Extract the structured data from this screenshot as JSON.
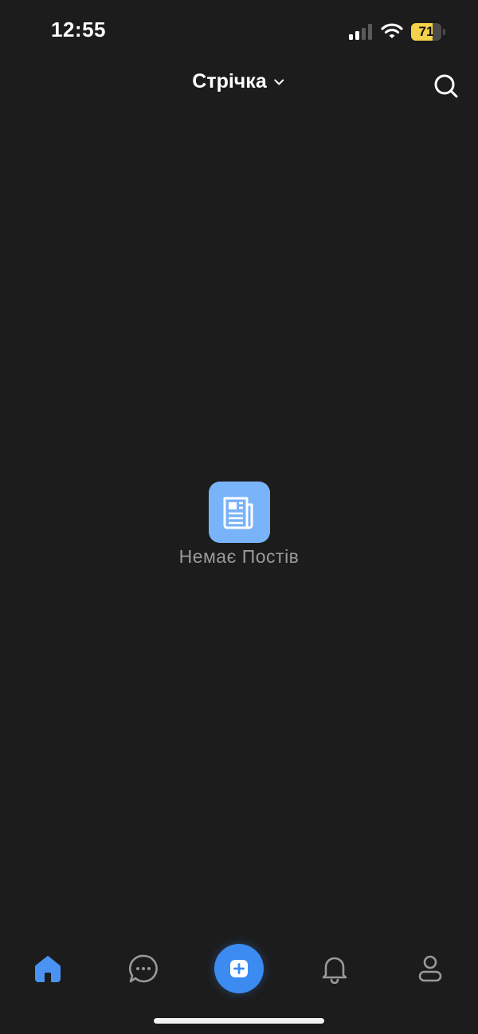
{
  "status_bar": {
    "time": "12:55",
    "battery_level": "71",
    "battery_fraction": 0.71,
    "battery_color": "#f5d24a"
  },
  "header": {
    "title": "Стрічка"
  },
  "empty_state": {
    "message": "Немає Постів",
    "icon": "newspaper-icon",
    "icon_bg": "#79b3f9"
  },
  "bottom_nav": {
    "active": "home",
    "accent_color": "#3b8bf0",
    "items": [
      {
        "id": "home",
        "icon": "home-icon"
      },
      {
        "id": "chat",
        "icon": "chat-bubble-icon"
      },
      {
        "id": "add",
        "icon": "plus-icon"
      },
      {
        "id": "notifications",
        "icon": "bell-icon"
      },
      {
        "id": "profile",
        "icon": "user-icon"
      }
    ]
  }
}
